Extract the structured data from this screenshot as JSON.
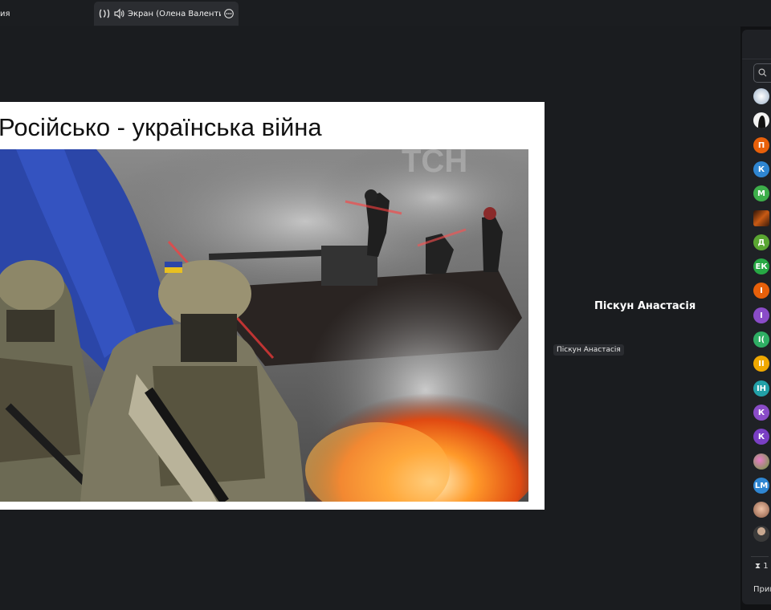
{
  "tabs": {
    "left_tab_fragment": "ия",
    "active_tab_label": "Экран (Олена Валентинівна",
    "active_tab_icons": [
      "camera-icon",
      "speaker-icon",
      "more-icon"
    ]
  },
  "slide": {
    "title": "Російсько - українська війна",
    "image_watermark": "ТСН"
  },
  "speaker": {
    "name": "Піскун Анастасія",
    "tag": "Піскун Анастасія"
  },
  "participants": {
    "search_icon": "search-icon",
    "avatars": [
      {
        "initials": "",
        "color": "#c9d3de",
        "kind": "photo-lightbulb"
      },
      {
        "initials": "",
        "color": "#e8e8e8",
        "kind": "photo-dark"
      },
      {
        "initials": "П",
        "color": "#e8600a"
      },
      {
        "initials": "К",
        "color": "#2f86d2"
      },
      {
        "initials": "М",
        "color": "#3dae4a"
      },
      {
        "initials": "",
        "color": "#7a2c0c",
        "kind": "photo-fire"
      },
      {
        "initials": "Д",
        "color": "#5aa632"
      },
      {
        "initials": "ЕК",
        "color": "#27a844"
      },
      {
        "initials": "І",
        "color": "#e8600a"
      },
      {
        "initials": "І",
        "color": "#8a4cc8"
      },
      {
        "initials": "І(",
        "color": "#2fae64"
      },
      {
        "initials": "ІІ",
        "color": "#f0a800"
      },
      {
        "initials": "ІН",
        "color": "#22a0a8"
      },
      {
        "initials": "К",
        "color": "#8a4cc8"
      },
      {
        "initials": "К",
        "color": "#7a3fc4"
      },
      {
        "initials": "",
        "color": "#b05a9c",
        "kind": "photo-flowers"
      },
      {
        "initials": "LM",
        "color": "#2f86d2"
      },
      {
        "initials": "",
        "color": "#d89a7c",
        "kind": "photo-face"
      },
      {
        "initials": "",
        "color": "#dcdcdc",
        "kind": "photo-person"
      }
    ],
    "footer_count": "1",
    "footer_invite": "Приг"
  }
}
